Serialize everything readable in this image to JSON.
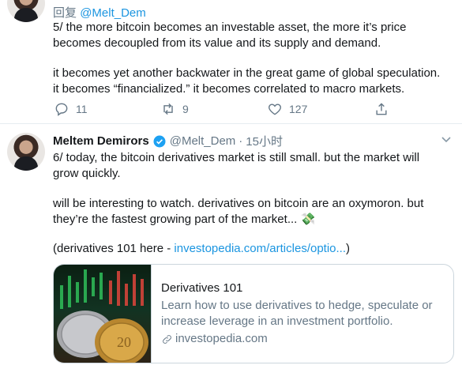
{
  "tweet1": {
    "reply_prefix": "回复",
    "reply_handle": "@Melt_Dem",
    "text_a": "5/ the more bitcoin becomes an investable asset, the more it’s price\nbecomes decoupled from its value and its supply and demand.",
    "text_b": "it becomes yet another backwater in the great game of global speculation.\nit becomes “financialized.” it becomes correlated to macro markets.",
    "actions": {
      "replies": "11",
      "retweets": "9",
      "likes": "127"
    }
  },
  "tweet2": {
    "name": "Meltem Demirors",
    "handle": "@Melt_Dem",
    "separator": "·",
    "time": "15小时",
    "text_a": "6/ today, the bitcoin derivatives market is still small. but the market will\ngrow quickly.",
    "text_b": "will be interesting to watch. derivatives on bitcoin are an oxymoron. but\nthey’re the fastest growing part of the market... 💸",
    "text_c_prefix": "(derivatives 101 here - ",
    "text_c_link": "investopedia.com/articles/optio...",
    "text_c_suffix": ")",
    "card": {
      "title": "Derivatives 101",
      "description": "Learn how to use derivatives to hedge, speculate or\nincrease leverage in an investment portfolio.",
      "domain": "investopedia.com"
    }
  },
  "colors": {
    "accent": "#1b95e0",
    "muted": "#657786",
    "text": "#14171a"
  }
}
